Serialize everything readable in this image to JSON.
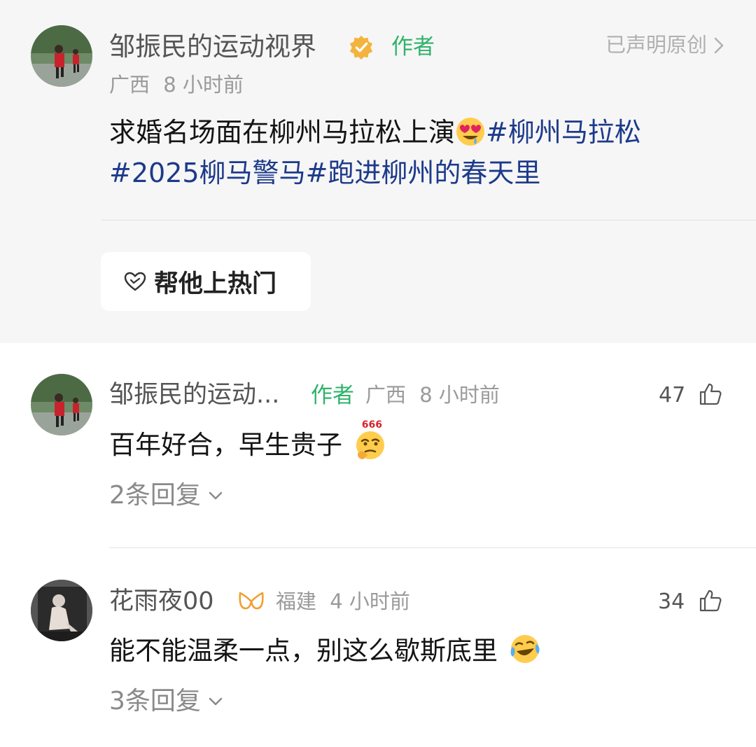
{
  "post": {
    "author": "邹振民的运动视界",
    "author_tag": "作者",
    "location": "广西",
    "time": "8 小时前",
    "original_label": "已声明原创",
    "text_prefix": "求婚名场面在柳州马拉松上演",
    "hashtags": [
      "#柳州马拉松",
      "#2025柳马警马",
      "#跑进柳州的春天里"
    ],
    "boost_label": "帮他上热门"
  },
  "comments": [
    {
      "author": "邹振民的运动...",
      "author_tag": "作者",
      "location": "广西",
      "time": "8 小时前",
      "likes": "47",
      "text": "百年好合，早生贵子",
      "emoji_badge": "666",
      "replies_label": "2条回复"
    },
    {
      "author": "花雨夜00",
      "location": "福建",
      "time": "4 小时前",
      "likes": "34",
      "text": "能不能温柔一点，别这么歇斯底里",
      "replies_label": "3条回复"
    }
  ],
  "colors": {
    "hashtag": "#1d3a8a",
    "author_tag": "#2fb36b",
    "post_background": "#f6f6f6"
  }
}
